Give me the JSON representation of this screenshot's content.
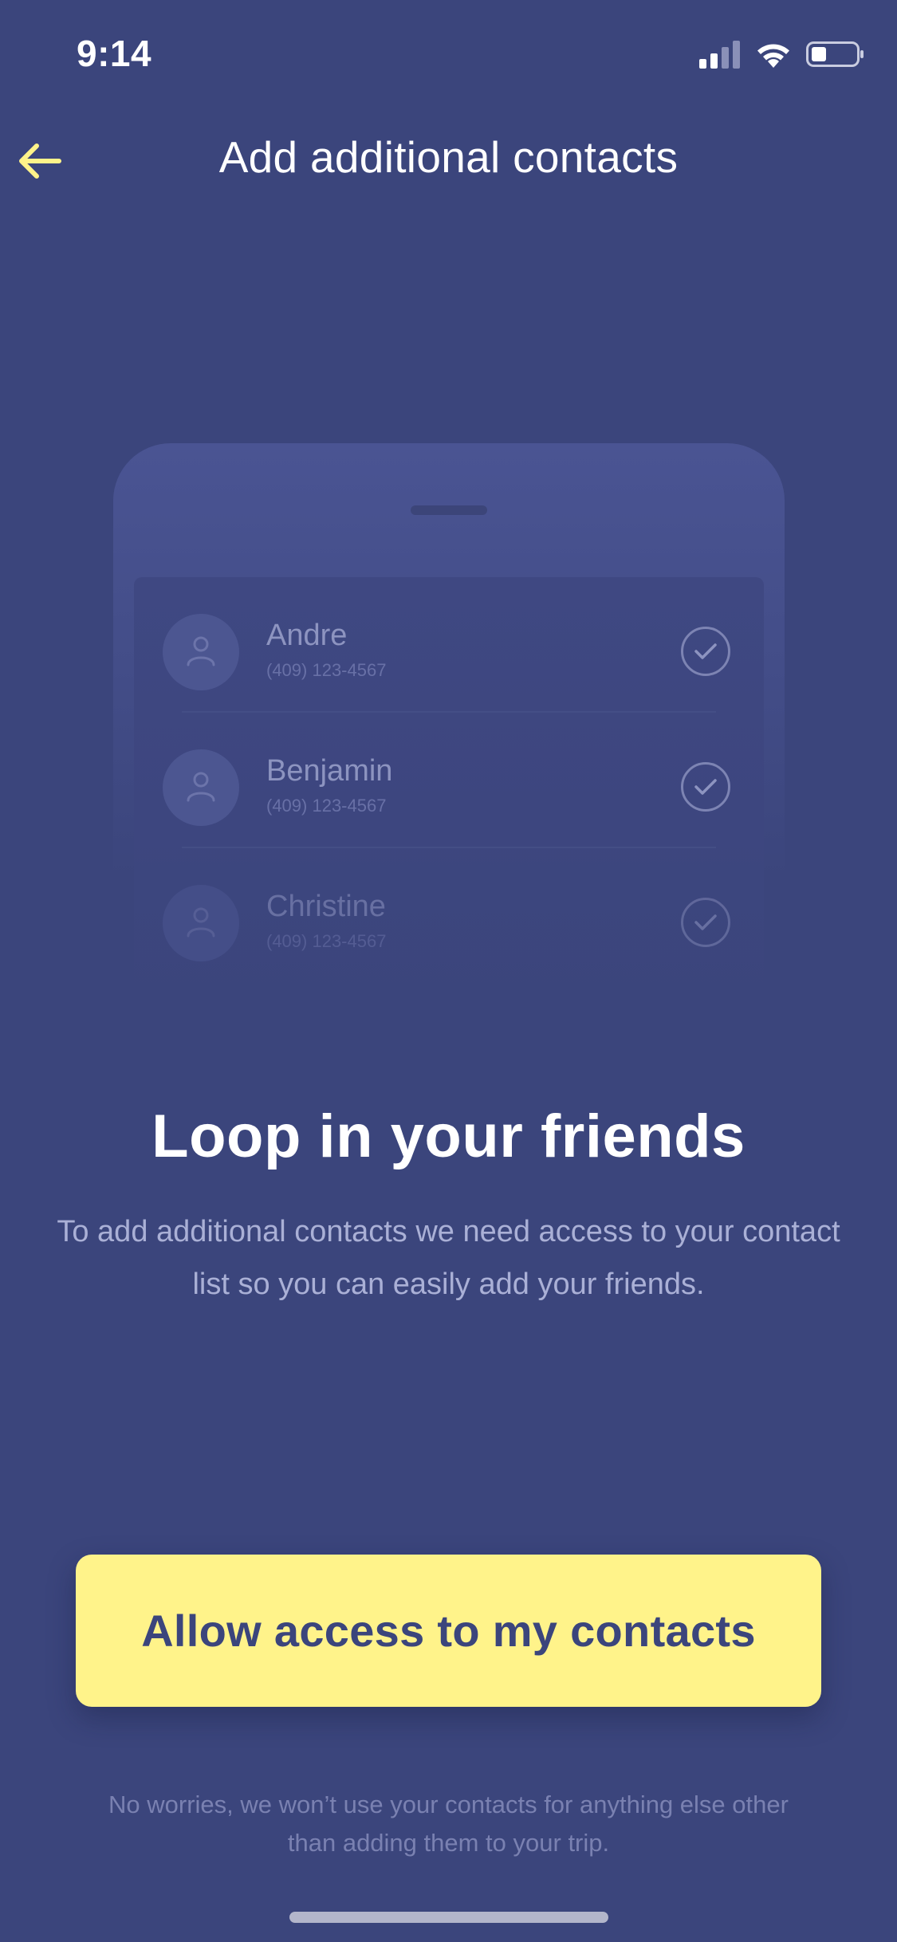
{
  "status_bar": {
    "time": "9:14",
    "icons": [
      "cellular-signal-icon",
      "wifi-icon",
      "battery-icon"
    ]
  },
  "nav": {
    "back_icon": "arrow-left-icon",
    "title": "Add additional contacts"
  },
  "illustration": {
    "contacts": [
      {
        "name": "Andre",
        "phone": "(409) 123-4567",
        "checked": true
      },
      {
        "name": "Benjamin",
        "phone": "(409) 123-4567",
        "checked": true
      },
      {
        "name": "Christine",
        "phone": "(409) 123-4567",
        "checked": true
      }
    ]
  },
  "content": {
    "headline": "Loop in your friends",
    "description": "To add additional contacts we need access to your contact list so you can easily add your friends."
  },
  "cta": {
    "label": "Allow access to my contacts"
  },
  "footnote": "No worries, we won’t use your contacts for anything else other than adding them to your trip.",
  "colors": {
    "background": "#3b457c",
    "accent": "#fff38a",
    "button_text": "#3b457c",
    "text_primary": "#ffffff",
    "text_secondary": "#aab0d6"
  }
}
